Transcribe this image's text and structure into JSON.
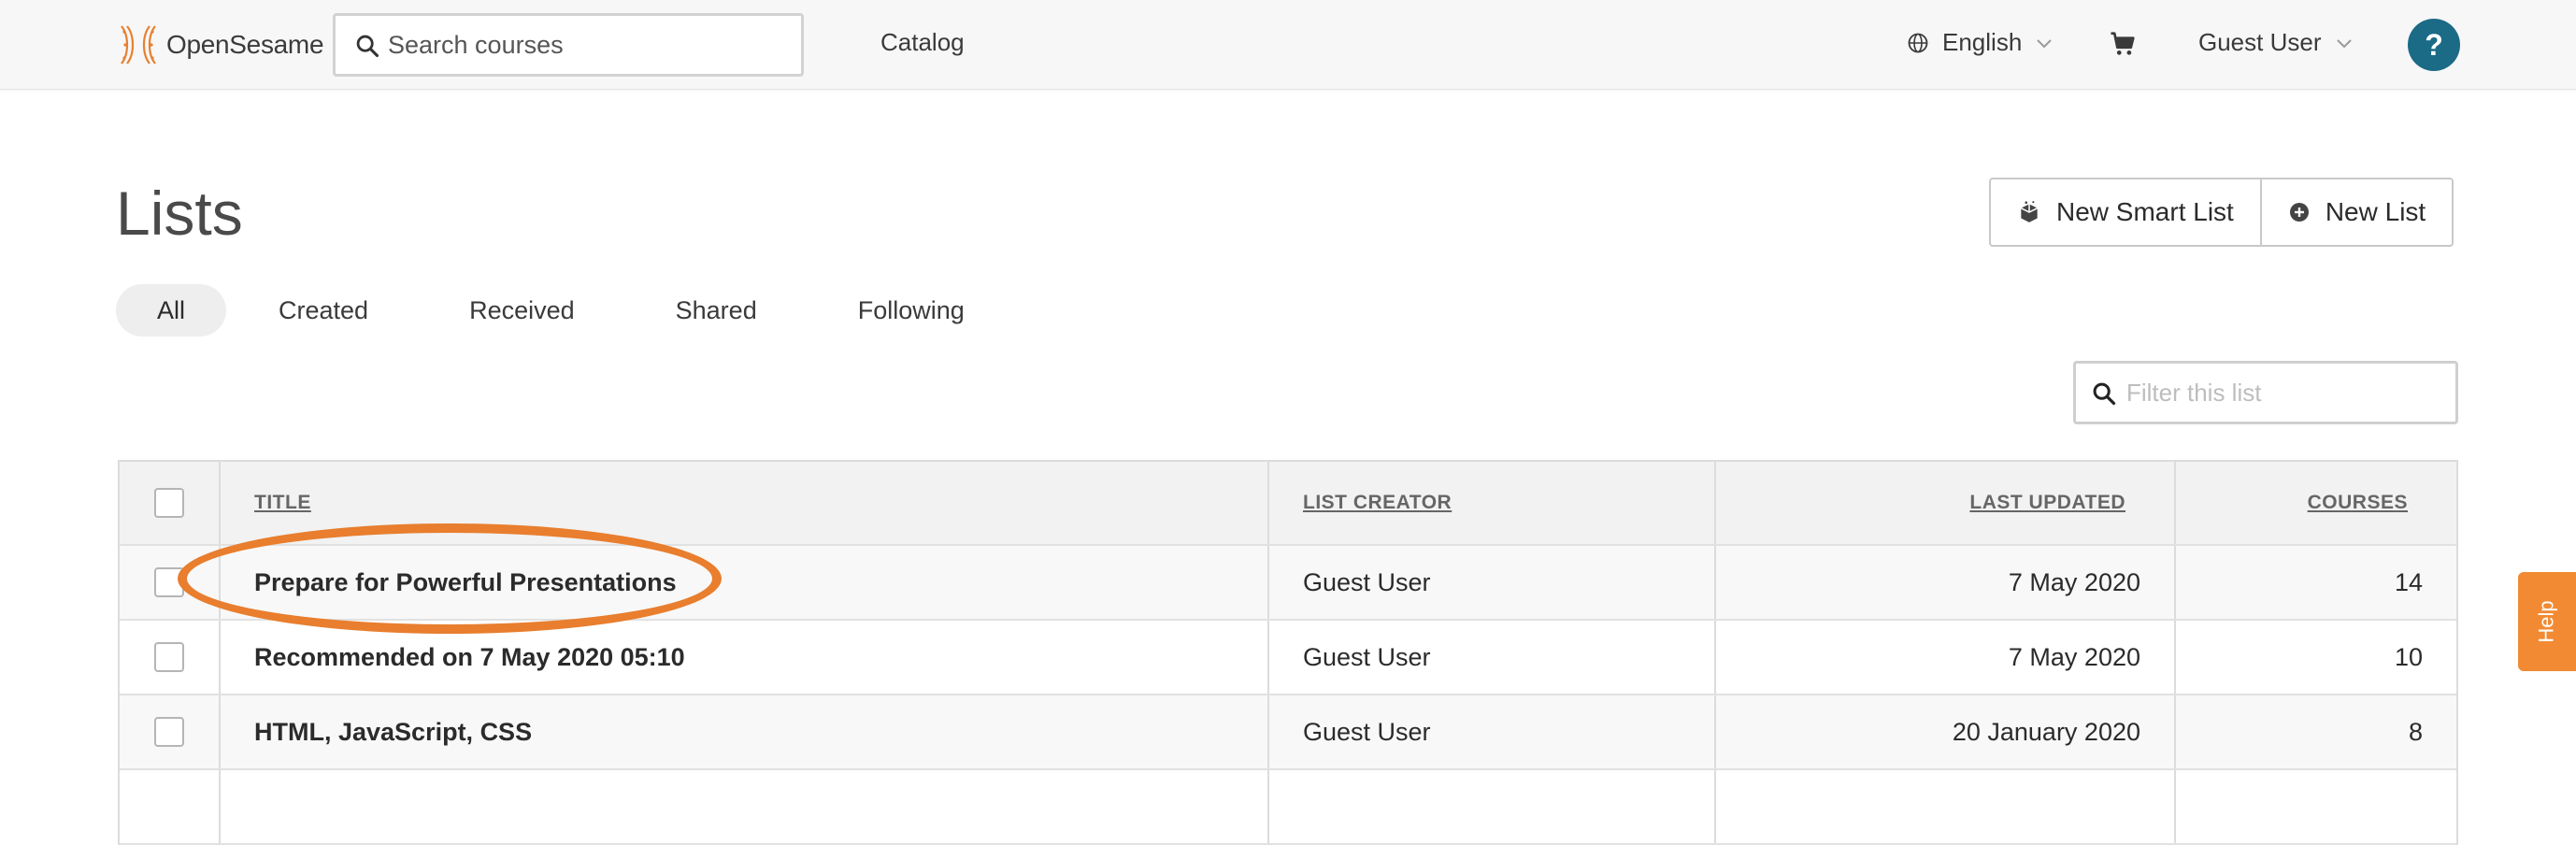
{
  "header": {
    "logo_text": "OpenSesame",
    "search_placeholder": "Search courses",
    "catalog_label": "Catalog",
    "language_label": "English",
    "user_label": "Guest User",
    "help_label": "?"
  },
  "page": {
    "title": "Lists",
    "new_smart_list_label": "New Smart List",
    "new_list_label": "New List",
    "filter_placeholder": "Filter this list"
  },
  "tabs": [
    "All",
    "Created",
    "Received",
    "Shared",
    "Following"
  ],
  "active_tab": "All",
  "table": {
    "columns": [
      "TITLE",
      "LIST CREATOR",
      "LAST UPDATED",
      "COURSES"
    ],
    "rows": [
      {
        "title": "Prepare for Powerful Presentations",
        "creator": "Guest User",
        "updated": "7 May 2020",
        "courses": "14"
      },
      {
        "title": "Recommended on 7 May 2020 05:10",
        "creator": "Guest User",
        "updated": "7 May 2020",
        "courses": "10"
      },
      {
        "title": "HTML, JavaScript, CSS",
        "creator": "Guest User",
        "updated": "20 January 2020",
        "courses": "8"
      }
    ]
  },
  "help_tab_label": "Help",
  "colors": {
    "accent_orange": "#e87e2e",
    "help_circle": "#1b6a86",
    "help_tab": "#f28a33"
  },
  "icons": {
    "search": "search-icon",
    "globe": "globe-icon",
    "cart": "cart-icon",
    "chevron": "chevron-down-icon",
    "smart_list": "smart-list-icon",
    "add": "plus-circle-icon"
  }
}
